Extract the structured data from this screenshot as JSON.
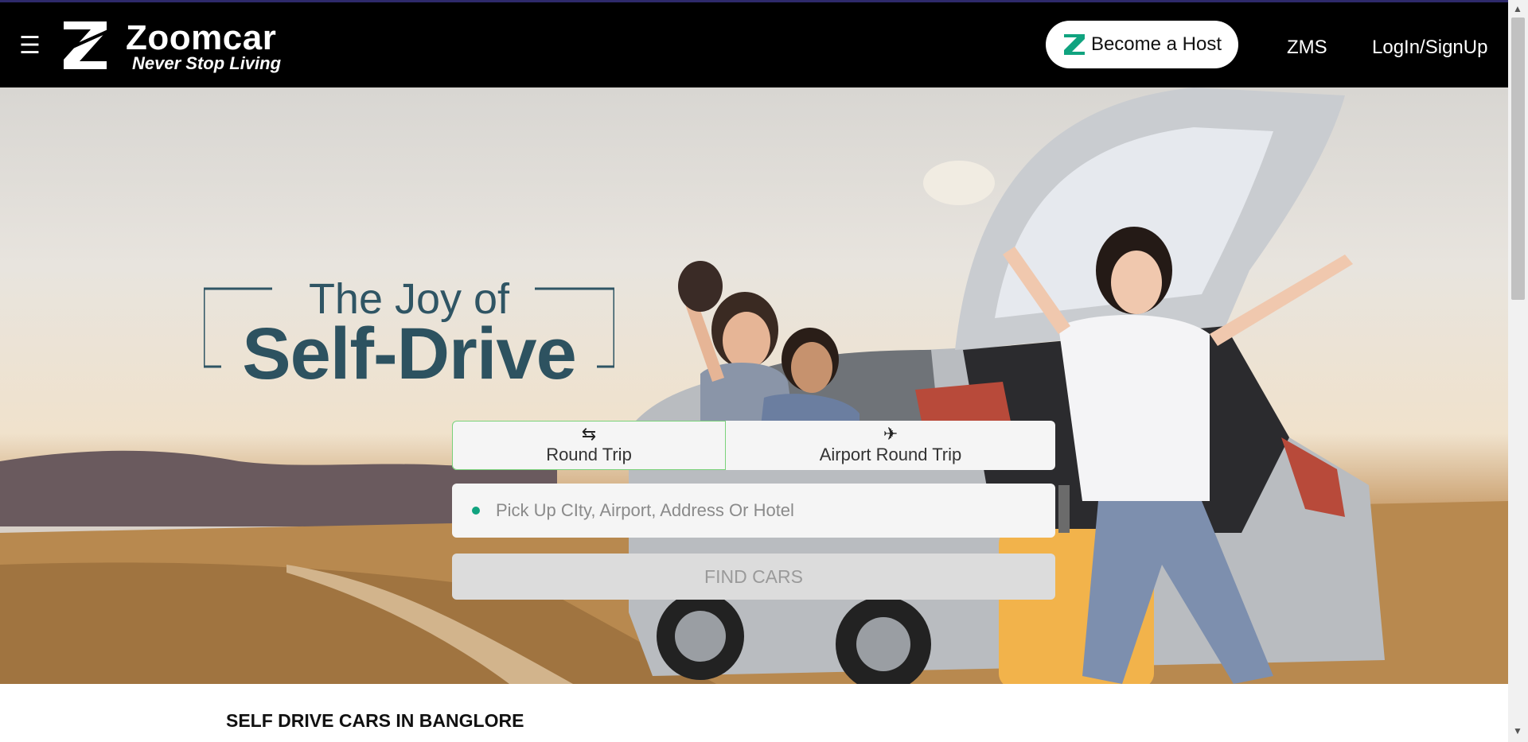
{
  "header": {
    "brand_name": "Zoomcar",
    "brand_tagline": "Never Stop Living",
    "menu_icon": "hamburger-icon",
    "become_host_label": "Become a Host",
    "zms_label": "ZMS",
    "login_label": "LogIn/SignUp"
  },
  "hero": {
    "title_top": "The Joy of",
    "title_main": "Self-Drive"
  },
  "search": {
    "tabs": [
      {
        "label": "Round Trip",
        "icon": "swap-arrows-icon",
        "active": true
      },
      {
        "label": "Airport Round Trip",
        "icon": "airplane-icon",
        "active": false
      }
    ],
    "pickup_placeholder": "Pick Up CIty, Airport, Address Or Hotel",
    "pickup_value": "",
    "find_button_label": "FIND CARS"
  },
  "section": {
    "title": "SELF DRIVE CARS IN BANGLORE"
  },
  "colors": {
    "header_bg": "#000000",
    "brand_green": "#10a37f",
    "title_color": "#2d5260"
  }
}
